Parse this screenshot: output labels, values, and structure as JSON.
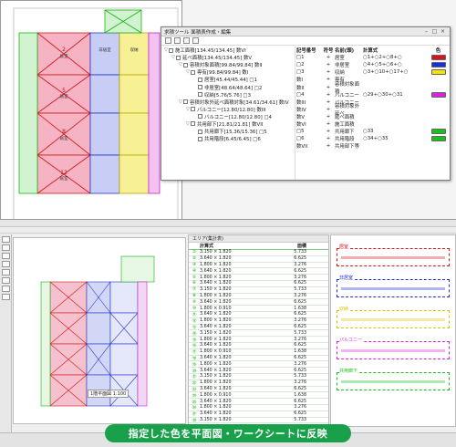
{
  "dialog": {
    "title": "求積ツール 面積表作成・編集",
    "tree": [
      {
        "indent": 0,
        "fold": "▽",
        "label": "施工面積[134.45/134.45] 数VI"
      },
      {
        "indent": 1,
        "fold": "▽",
        "label": "延べ面積[134.45/134.45] 数V"
      },
      {
        "indent": 2,
        "fold": "▽",
        "label": "容積対象面積[99.84/99.84] 数II"
      },
      {
        "indent": 3,
        "fold": "▽",
        "label": "専有[99.84/99.84] 数I"
      },
      {
        "indent": 4,
        "fold": "",
        "label": "居室[45.44/45.44] □1"
      },
      {
        "indent": 4,
        "fold": "",
        "label": "非居室[48.64/48.64] □2"
      },
      {
        "indent": 4,
        "fold": "",
        "label": "収納[5.76/5.76] □3"
      },
      {
        "indent": 2,
        "fold": "▽",
        "label": "容積対象外延べ面積対象[34.61/34.61] 数IV"
      },
      {
        "indent": 3,
        "fold": "▽",
        "label": "バルコニー[12.80/12.80] 数III"
      },
      {
        "indent": 4,
        "fold": "",
        "label": "バルコニー[12.80/12.80] □4"
      },
      {
        "indent": 3,
        "fold": "▽",
        "label": "共用部下[21.81/21.81] 数VII"
      },
      {
        "indent": 4,
        "fold": "",
        "label": "共用廊下[15.36/15.36] □5"
      },
      {
        "indent": 4,
        "fold": "",
        "label": "共用階段[6.45/6.45] □6"
      }
    ],
    "columns": [
      "記号番号",
      "符号",
      "名前(頭)",
      "計算式",
      "色"
    ],
    "rows": [
      {
        "code": "□1",
        "sign": "+",
        "name": "居室",
        "formula": "○1+○2+○8+○",
        "color": "#e0101a"
      },
      {
        "code": "□2",
        "sign": "+",
        "name": "非居室",
        "formula": "○4+○5+○6+○",
        "color": "#1a2ee0"
      },
      {
        "code": "□3",
        "sign": "+",
        "name": "収納",
        "formula": "○3+○10+○17+○",
        "color": "#f5e400"
      },
      {
        "code": "数I",
        "sign": "+",
        "name": "専有",
        "formula": "",
        "color": ""
      },
      {
        "code": "数II",
        "sign": "+",
        "name": "容積対象面積",
        "formula": "",
        "color": ""
      },
      {
        "code": "□4",
        "sign": "+",
        "name": "バルコニー",
        "formula": "○29+○30+○31",
        "color": "#e020e0"
      },
      {
        "code": "数III",
        "sign": "+",
        "name": "バルコニー",
        "formula": "",
        "color": ""
      },
      {
        "code": "数IV",
        "sign": "+",
        "name": "容積対象外延べ",
        "formula": "",
        "color": ""
      },
      {
        "code": "数V",
        "sign": "+",
        "name": "延べ面積",
        "formula": "",
        "color": ""
      },
      {
        "code": "数VI",
        "sign": "+",
        "name": "施工面積",
        "formula": "",
        "color": ""
      },
      {
        "code": "□5",
        "sign": "+",
        "name": "共用廊下",
        "formula": "○33",
        "color": "#18c018"
      },
      {
        "code": "□6",
        "sign": "+",
        "name": "共用階段",
        "formula": "○34+○35",
        "color": "#18c018"
      },
      {
        "code": "数VII",
        "sign": "+",
        "name": "共用部下等",
        "formula": "",
        "color": ""
      }
    ]
  },
  "worksheet": {
    "header": "エリア(集計表)",
    "columns": [
      "",
      "計算式",
      "面積"
    ],
    "rows": [
      [
        "①",
        "3.150 × 1.820",
        "5.733"
      ],
      [
        "②",
        "3.640 × 1.820",
        "6.625"
      ],
      [
        "③",
        "1.800 × 1.820",
        "3.276"
      ],
      [
        "④",
        "3.640 × 1.820",
        "6.625"
      ],
      [
        "⑤",
        "1.800 × 1.820",
        "3.276"
      ],
      [
        "⑥",
        "3.640 × 1.820",
        "6.625"
      ],
      [
        "⑦",
        "3.150 × 1.820",
        "5.733"
      ],
      [
        "⑧",
        "1.800 × 1.820",
        "3.276"
      ],
      [
        "⑨",
        "3.640 × 1.820",
        "6.625"
      ],
      [
        "⑩",
        "1.800 × 0.910",
        "1.638"
      ],
      [
        "⑪",
        "3.640 × 1.820",
        "6.625"
      ],
      [
        "⑫",
        "1.800 × 1.820",
        "3.276"
      ],
      [
        "⑬",
        "3.640 × 1.820",
        "6.625"
      ],
      [
        "⑭",
        "3.150 × 1.820",
        "5.733"
      ],
      [
        "⑮",
        "1.800 × 1.820",
        "3.276"
      ],
      [
        "⑯",
        "3.640 × 1.820",
        "6.625"
      ],
      [
        "⑰",
        "1.800 × 0.910",
        "1.638"
      ],
      [
        "⑱",
        "3.640 × 1.820",
        "6.625"
      ],
      [
        "⑲",
        "1.800 × 1.820",
        "3.276"
      ],
      [
        "⑳",
        "3.640 × 1.820",
        "6.625"
      ],
      [
        "㉑",
        "3.150 × 1.820",
        "5.733"
      ],
      [
        "㉒",
        "1.800 × 1.820",
        "3.276"
      ],
      [
        "㉓",
        "3.640 × 1.820",
        "6.625"
      ],
      [
        "㉔",
        "1.800 × 0.910",
        "1.638"
      ],
      [
        "㉕",
        "3.640 × 1.820",
        "6.625"
      ],
      [
        "㉖",
        "1.800 × 1.820",
        "3.276"
      ],
      [
        "㉗",
        "3.640 × 1.820",
        "6.625"
      ],
      [
        "㉘",
        "3.150 × 1.820",
        "5.733"
      ]
    ]
  },
  "right_panel": {
    "sections": [
      {
        "label": "居室",
        "color": "#e0101a"
      },
      {
        "label": "非居室",
        "color": "#1a2ee0"
      },
      {
        "label": "収納",
        "color": "#d6c400"
      },
      {
        "label": "バルコニー",
        "color": "#e020e0"
      },
      {
        "label": "共用廊下",
        "color": "#18c018"
      }
    ]
  },
  "plan": {
    "scale_label": "1階平面図 1:100",
    "room_labels": [
      "居室",
      "非居室",
      "収納"
    ]
  },
  "banner": "指定した色を平面図・ワークシートに反映"
}
